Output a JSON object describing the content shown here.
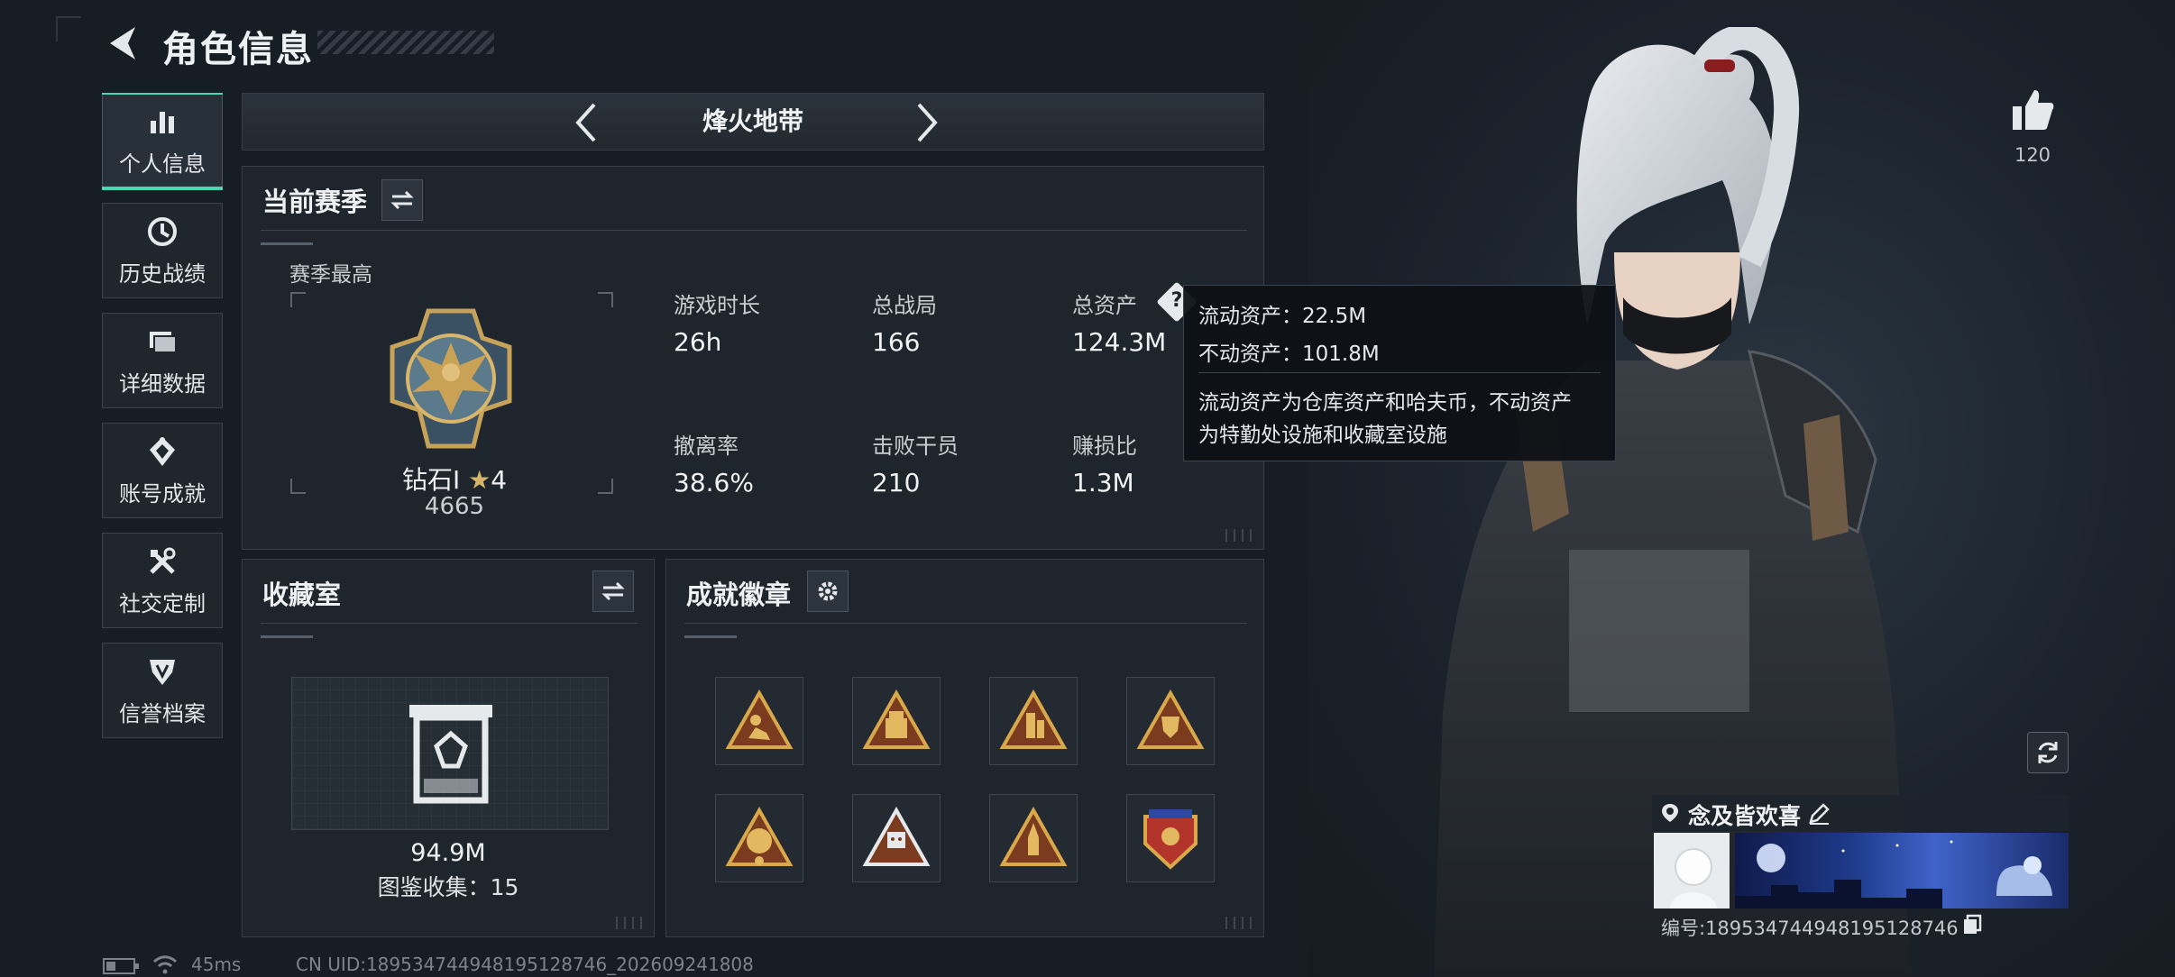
{
  "header": {
    "title": "角色信息"
  },
  "nav": {
    "items": [
      {
        "label": "个人信息",
        "icon": "bar-chart-icon",
        "active": true
      },
      {
        "label": "历史战绩",
        "icon": "history-icon"
      },
      {
        "label": "详细数据",
        "icon": "folder-icon"
      },
      {
        "label": "账号成就",
        "icon": "achievement-icon"
      },
      {
        "label": "社交定制",
        "icon": "tools-icon"
      },
      {
        "label": "信誉档案",
        "icon": "credit-shield-icon"
      }
    ]
  },
  "mode": {
    "name": "烽火地带"
  },
  "season": {
    "title": "当前赛季",
    "best_label": "赛季最高",
    "rank_name": "钻石Ⅰ",
    "rank_stars": "4",
    "rank_score": "4665",
    "stats": [
      {
        "label": "游戏时长",
        "value": "26h"
      },
      {
        "label": "总战局",
        "value": "166"
      },
      {
        "label": "总资产",
        "value": "124.3M"
      },
      {
        "label": "撤离率",
        "value": "38.6%"
      },
      {
        "label": "击败干员",
        "value": "210"
      },
      {
        "label": "赚损比",
        "value": "1.3M"
      }
    ]
  },
  "tooltip": {
    "liquid": "流动资产：22.5M",
    "fixed": "不动资产：101.8M",
    "desc1": "流动资产为仓库资产和哈夫币，不动资产",
    "desc2": "为特勤处设施和收藏室设施"
  },
  "collection": {
    "title": "收藏室",
    "value": "94.9M",
    "count_label": "图鉴收集：15"
  },
  "badges": {
    "title": "成就徽章"
  },
  "profile": {
    "likes": "120",
    "name": "念及皆欢喜",
    "id": "编号:1895347449481951287​46"
  },
  "status": {
    "ping": "45ms",
    "uid": "CN UID:189534744948195128746_202609241808"
  }
}
